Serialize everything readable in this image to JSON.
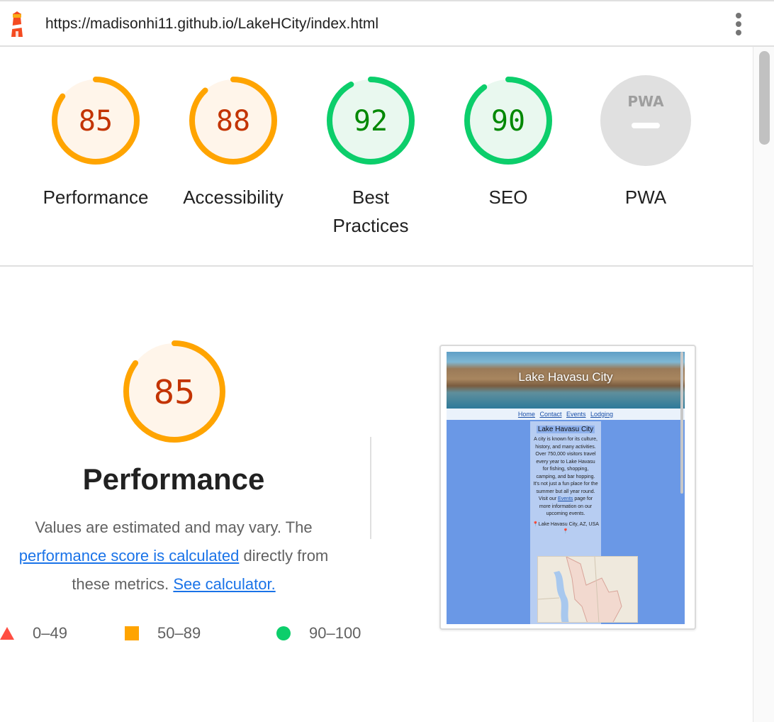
{
  "browser": {
    "url": "https://madisonhi11.github.io/LakeHCity/index.html",
    "logo_icon": "lighthouse-icon",
    "menu_icon": "kebab-menu-icon"
  },
  "colors": {
    "average": "#ffa400",
    "average_text": "#c33300",
    "average_bg": "#fff5ea",
    "pass": "#0cce6b",
    "pass_text": "#008800",
    "pass_bg": "#e9f8ef",
    "na_bg": "#e0e0e0",
    "link": "#1a73e8"
  },
  "gauges": [
    {
      "id": "performance",
      "score": 85,
      "score_text": "85",
      "label": "Performance",
      "rating": "average"
    },
    {
      "id": "accessibility",
      "score": 88,
      "score_text": "88",
      "label": "Accessibility",
      "rating": "average"
    },
    {
      "id": "best-practices",
      "score": 92,
      "score_text": "92",
      "label_line1": "Best",
      "label_line2": "Practices",
      "rating": "pass"
    },
    {
      "id": "seo",
      "score": 90,
      "score_text": "90",
      "label": "SEO",
      "rating": "pass"
    },
    {
      "id": "pwa",
      "badge_text": "PWA",
      "label": "PWA",
      "rating": "na"
    }
  ],
  "performance": {
    "score": 85,
    "score_text": "85",
    "title": "Performance",
    "desc_part1": "Values are estimated and may vary. The",
    "desc_link1": "performance score is calculated",
    "desc_part2": "directly from",
    "desc_part3": "these metrics.",
    "desc_link2": "See calculator."
  },
  "legend": [
    {
      "range": "0–49",
      "shape": "triangle"
    },
    {
      "range": "50–89",
      "shape": "square"
    },
    {
      "range": "90–100",
      "shape": "circle"
    }
  ],
  "thumbnail": {
    "hero_title": "Lake Havasu City",
    "nav": [
      "Home",
      "Contact",
      "Events",
      "Lodging"
    ],
    "heading": "Lake Havasu City",
    "para_before_link": "A city is known for its culture, history, and many activities. Over 750,000 visitors travel every year to Lake Havasu for fishing, shopping, camping, and bar hopping. It's not just a fun place for the summer but all year round. Visit our",
    "para_link": "Events",
    "para_after_link": "page for more information on our upcoming events.",
    "location": "📍Lake Havasu City, AZ, USA📍"
  }
}
